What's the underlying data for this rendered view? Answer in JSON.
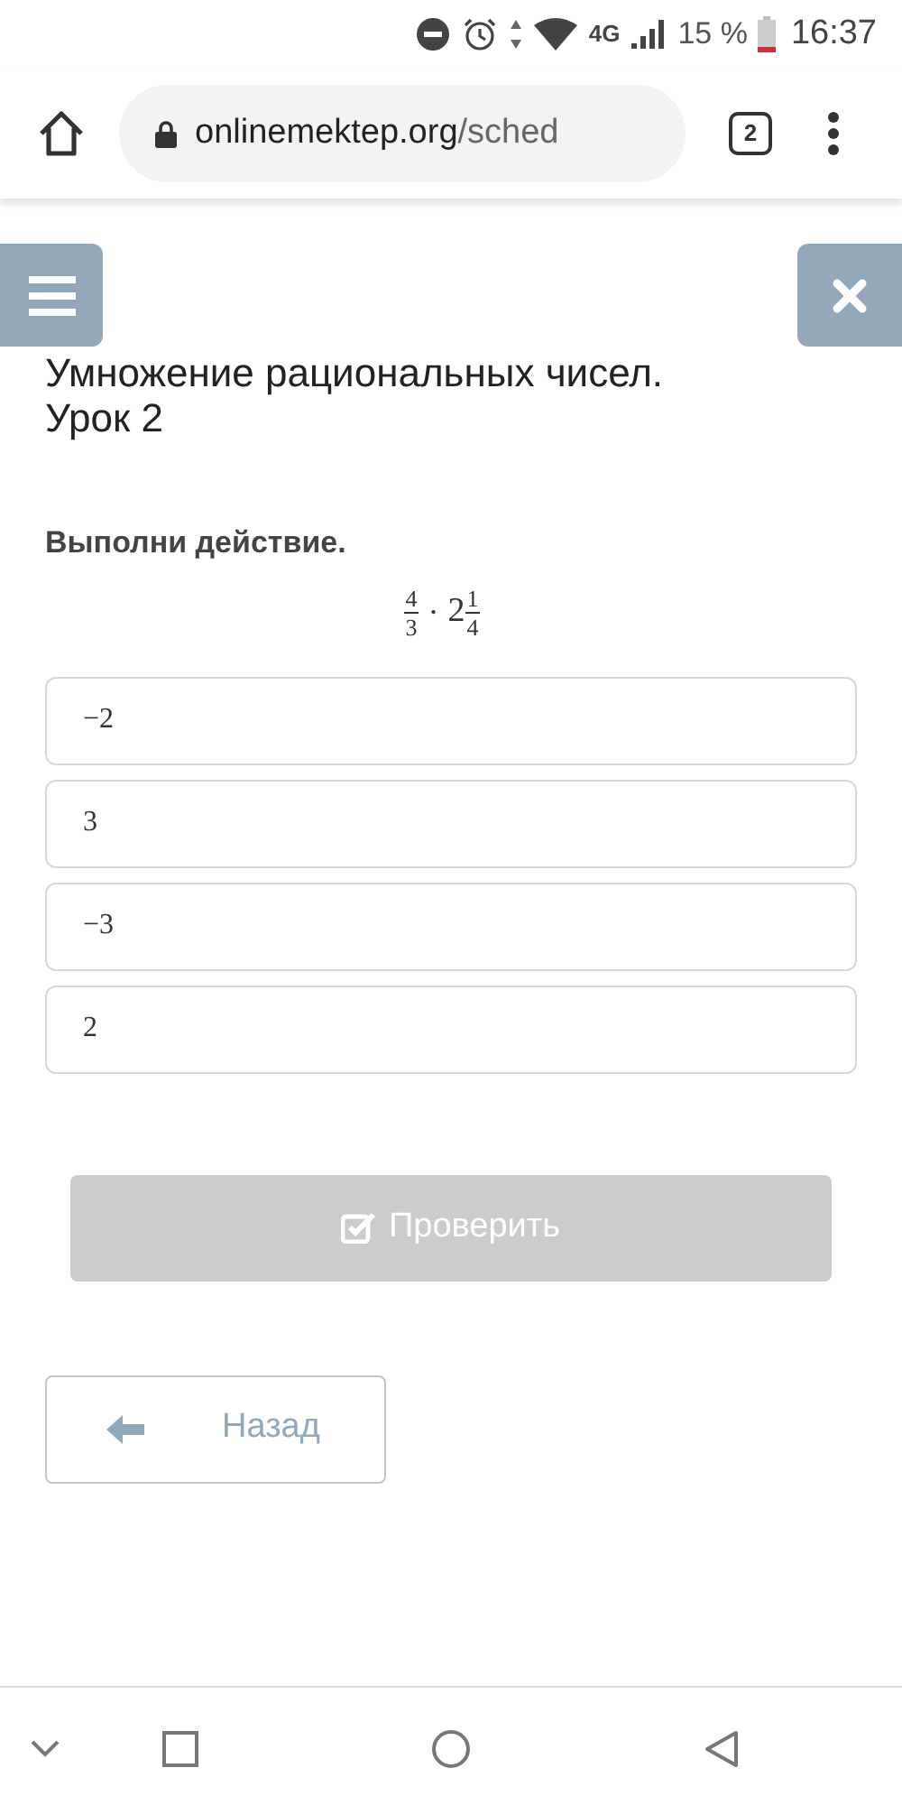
{
  "status_bar": {
    "network": "4G",
    "battery_text": "15 %",
    "time": "16:37"
  },
  "browser": {
    "url_host": "onlinemektep.org",
    "url_path": "/sched",
    "tab_count": "2"
  },
  "lesson": {
    "title": "Умножение рациональных чисел. Урок 2"
  },
  "question": {
    "prompt": "Выполни действие.",
    "expression": {
      "fraction1": {
        "num": "4",
        "den": "3"
      },
      "operator": "·",
      "whole": "2",
      "fraction2": {
        "num": "1",
        "den": "4"
      }
    }
  },
  "options": [
    {
      "text": "−2",
      "selected": false
    },
    {
      "text": "3",
      "selected": false
    },
    {
      "text": "−3",
      "selected": false
    },
    {
      "text": "2",
      "selected": false
    }
  ],
  "check_button": {
    "label": "Проверить",
    "disabled": true
  },
  "back_button": {
    "label": "Назад"
  }
}
